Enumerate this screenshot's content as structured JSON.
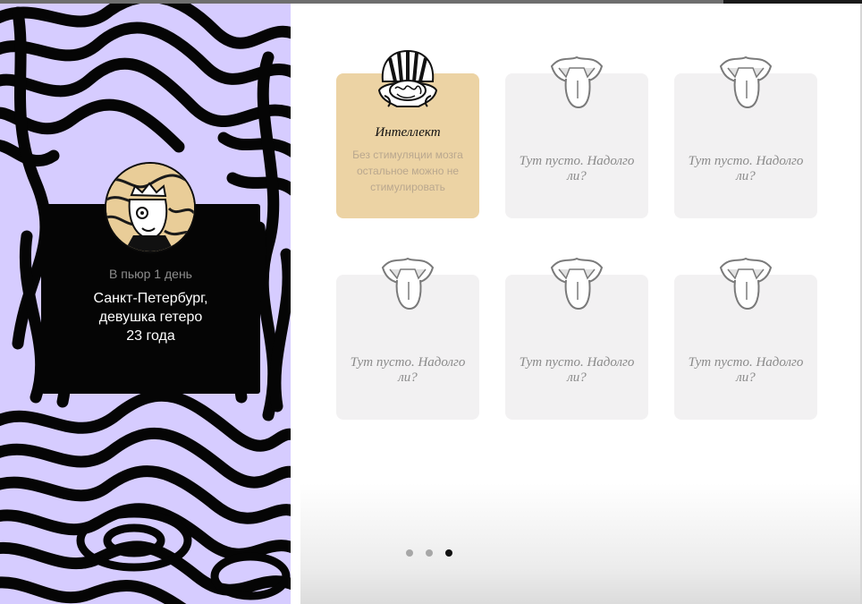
{
  "profile": {
    "meta": "В пьюр 1 день",
    "desc_line1": "Санкт-Петербург,",
    "desc_line2": "девушка гетеро",
    "desc_line3": "23 года"
  },
  "cards": [
    {
      "title": "Интеллект",
      "text": "Без стимуляции мозга остальное можно не стимулировать",
      "icon": "brain-icon"
    },
    {
      "empty_text": "Тут пусто. Надолго ли?",
      "icon": "mouth-icon"
    },
    {
      "empty_text": "Тут пусто. Надолго ли?",
      "icon": "mouth-icon"
    },
    {
      "empty_text": "Тут пусто. Надолго ли?",
      "icon": "mouth-icon"
    },
    {
      "empty_text": "Тут пусто. Надолго ли?",
      "icon": "mouth-icon"
    },
    {
      "empty_text": "Тут пусто. Надолго ли?",
      "icon": "mouth-icon"
    }
  ],
  "pagination": {
    "count": 3,
    "active_index": 2
  },
  "colors": {
    "accent_card": "#ecd3a4",
    "stripe_light": "#d6ccff",
    "stripe_dark": "#050505"
  }
}
